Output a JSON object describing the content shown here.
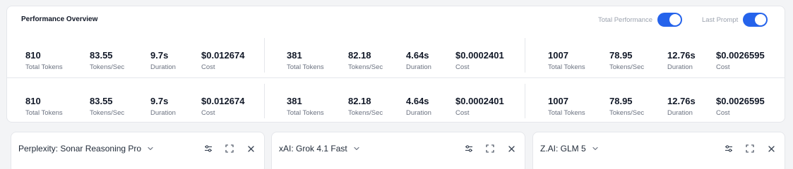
{
  "overview": {
    "title": "Performance Overview",
    "toggles": [
      {
        "label": "Total Performance",
        "on": true
      },
      {
        "label": "Last Prompt",
        "on": true
      }
    ],
    "accent": "#2563eb",
    "rows": [
      {
        "groups": [
          {
            "metrics": [
              {
                "value": "810",
                "label": "Total Tokens"
              },
              {
                "value": "83.55",
                "label": "Tokens/Sec"
              },
              {
                "value": "9.7s",
                "label": "Duration"
              },
              {
                "value": "$0.012674",
                "label": "Cost"
              }
            ]
          },
          {
            "metrics": [
              {
                "value": "381",
                "label": "Total Tokens"
              },
              {
                "value": "82.18",
                "label": "Tokens/Sec"
              },
              {
                "value": "4.64s",
                "label": "Duration"
              },
              {
                "value": "$0.0002401",
                "label": "Cost"
              }
            ]
          },
          {
            "metrics": [
              {
                "value": "1007",
                "label": "Total Tokens"
              },
              {
                "value": "78.95",
                "label": "Tokens/Sec"
              },
              {
                "value": "12.76s",
                "label": "Duration"
              },
              {
                "value": "$0.0026595",
                "label": "Cost"
              }
            ]
          }
        ]
      },
      {
        "groups": [
          {
            "metrics": [
              {
                "value": "810",
                "label": "Total Tokens"
              },
              {
                "value": "83.55",
                "label": "Tokens/Sec"
              },
              {
                "value": "9.7s",
                "label": "Duration"
              },
              {
                "value": "$0.012674",
                "label": "Cost"
              }
            ]
          },
          {
            "metrics": [
              {
                "value": "381",
                "label": "Total Tokens"
              },
              {
                "value": "82.18",
                "label": "Tokens/Sec"
              },
              {
                "value": "4.64s",
                "label": "Duration"
              },
              {
                "value": "$0.0002401",
                "label": "Cost"
              }
            ]
          },
          {
            "metrics": [
              {
                "value": "1007",
                "label": "Total Tokens"
              },
              {
                "value": "78.95",
                "label": "Tokens/Sec"
              },
              {
                "value": "12.76s",
                "label": "Duration"
              },
              {
                "value": "$0.0026595",
                "label": "Cost"
              }
            ]
          }
        ]
      }
    ]
  },
  "panels": [
    {
      "model": "Perplexity: Sonar Reasoning Pro",
      "icons": [
        "chevron-down-icon",
        "sliders-icon",
        "expand-icon",
        "close-icon"
      ]
    },
    {
      "model": "xAI: Grok 4.1 Fast",
      "icons": [
        "chevron-down-icon",
        "sliders-icon",
        "expand-icon",
        "close-icon"
      ]
    },
    {
      "model": "Z.AI: GLM 5",
      "icons": [
        "chevron-down-icon",
        "sliders-icon",
        "expand-icon",
        "close-icon"
      ]
    }
  ]
}
